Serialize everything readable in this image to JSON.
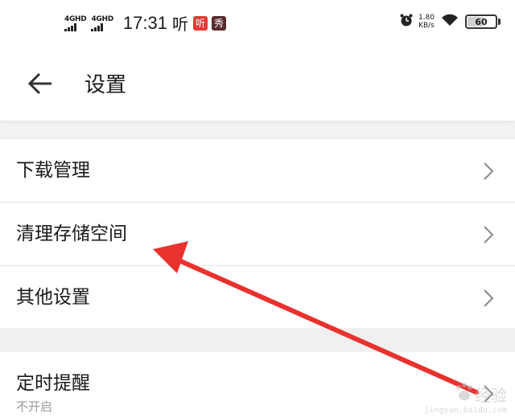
{
  "status_bar": {
    "network_1": "4GHD",
    "network_2": "4GHD",
    "time": "17:31",
    "app_glyph": "听",
    "app_badge_red": "听",
    "app_badge_dark": "秀",
    "speed_value": "1.80",
    "speed_unit": "KB/s",
    "battery": "60",
    "battery_level": 0.6
  },
  "header": {
    "title": "设置",
    "back_icon": "arrow-left-icon"
  },
  "settings": {
    "items": [
      {
        "label": "下载管理",
        "icon": "chevron-right-icon"
      },
      {
        "label": "清理存储空间",
        "icon": "chevron-right-icon"
      },
      {
        "label": "其他设置",
        "icon": "chevron-right-icon"
      }
    ],
    "timer": {
      "label": "定时提醒",
      "value": "不开启",
      "icon": "chevron-right-icon"
    }
  },
  "annotation": {
    "color": "#e8322e",
    "icon": "pointer-arrow"
  },
  "watermark": {
    "text": "经验",
    "url": "jingyan.baidu.com"
  }
}
